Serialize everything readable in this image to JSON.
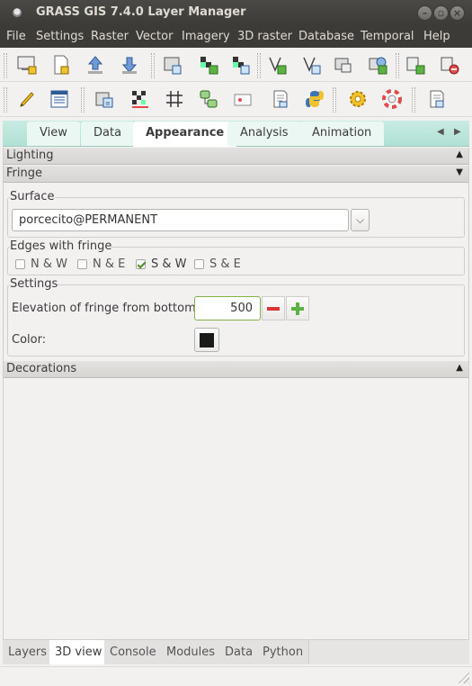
{
  "window": {
    "title": "GRASS GIS 7.4.0 Layer Manager"
  },
  "menu": [
    "File",
    "Settings",
    "Raster",
    "Vector",
    "Imagery",
    "3D raster",
    "Database",
    "Temporal",
    "Help"
  ],
  "toolbar1": [
    {
      "icon": "new-display-icon"
    },
    {
      "icon": "new-workspace-icon"
    },
    {
      "icon": "load-workspace-icon"
    },
    {
      "icon": "import-icon"
    },
    {
      "icon": "add-raster-icon"
    },
    {
      "icon": "add-raster-misc-icon"
    },
    {
      "icon": "add-vector-icon"
    },
    {
      "icon": "add-vector-misc-icon"
    },
    {
      "icon": "add-overlay-icon"
    },
    {
      "icon": "add-web-service-icon"
    },
    {
      "icon": "add-group-icon"
    },
    {
      "icon": "delete-layer-icon"
    }
  ],
  "toolbar2": [
    {
      "icon": "vector-digitizer-icon"
    },
    {
      "icon": "attribute-table-icon"
    },
    {
      "icon": "map-calculator-icon"
    },
    {
      "icon": "georectify-icon"
    },
    {
      "icon": "graphical-modeler-icon"
    },
    {
      "icon": "map-swipe-icon"
    },
    {
      "icon": "cartographic-composer-icon"
    },
    {
      "icon": "script-file-icon"
    },
    {
      "icon": "python-icon"
    },
    {
      "icon": "settings-icon"
    },
    {
      "icon": "help-icon"
    },
    {
      "icon": "quit-icon"
    }
  ],
  "notebook_tabs": [
    "View",
    "Data",
    "Appearance",
    "Analysis",
    "Animation"
  ],
  "active_tab": "Appearance",
  "sections": {
    "lighting": "Lighting",
    "fringe": "Fringe",
    "decorations": "Decorations"
  },
  "fringe": {
    "surface_label": "Surface",
    "surface_value": "porcecito@PERMANENT",
    "edges_label": "Edges with fringe",
    "edges": [
      {
        "label": "N & W",
        "checked": false
      },
      {
        "label": "N & E",
        "checked": false
      },
      {
        "label": "S & W",
        "checked": true
      },
      {
        "label": "S & E",
        "checked": false
      }
    ],
    "settings_label": "Settings",
    "elevation_label": "Elevation of fringe from bottom:",
    "elevation_value": "500",
    "color_label": "Color:",
    "color_value": "#1a1a1a"
  },
  "bottom_tabs": [
    "Layers",
    "3D view",
    "Console",
    "Modules",
    "Data",
    "Python"
  ],
  "active_bottom_tab": "3D view"
}
